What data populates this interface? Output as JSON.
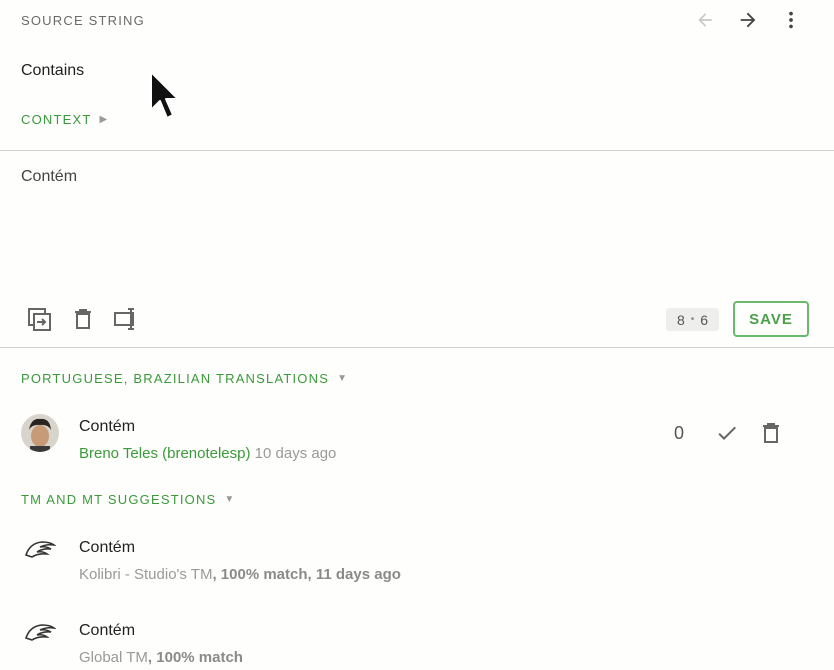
{
  "source": {
    "label": "Source string",
    "text": "Contains",
    "context_label": "Context"
  },
  "editor": {
    "text": "Contém",
    "counter_left": "8",
    "counter_sep": "•",
    "counter_right": "6",
    "save_label": "Save"
  },
  "translations": {
    "heading": "Portuguese, Brazilian translations",
    "items": [
      {
        "text": "Contém",
        "user": "Breno Teles (brenotelesp)",
        "time": "10 days ago",
        "votes": "0"
      }
    ]
  },
  "suggestions": {
    "heading": "TM and MT suggestions",
    "items": [
      {
        "text": "Contém",
        "source": "Kolibri - Studio's TM",
        "match": ", 100% match, 11 days ago"
      },
      {
        "text": "Contém",
        "source": "Global TM",
        "match": ", 100% match"
      }
    ]
  },
  "icons": {
    "prev": "arrow-left-icon",
    "next": "arrow-right-icon",
    "menu": "more-vertical-icon",
    "copy": "copy-source-icon",
    "clear": "trash-icon",
    "special": "special-characters-icon",
    "approve": "check-icon",
    "delete": "trash-icon",
    "tm": "tm-source-icon"
  },
  "colors": {
    "accent": "#3a9a3a",
    "save_border": "#6ab86a",
    "muted": "#999999"
  }
}
